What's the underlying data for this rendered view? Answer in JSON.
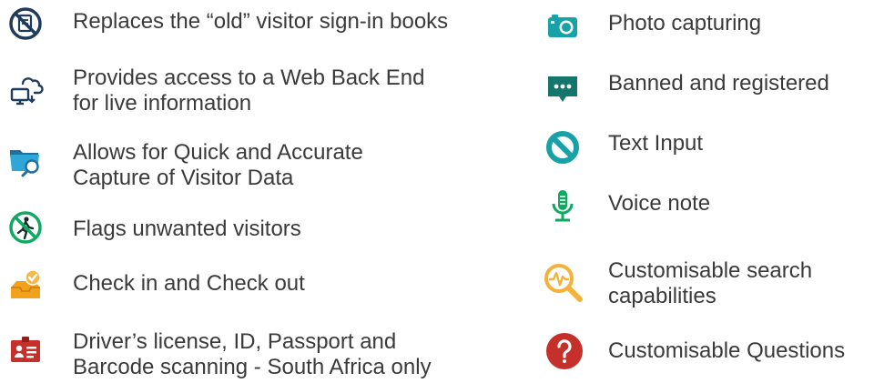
{
  "colors": {
    "navy": "#1f3b5c",
    "teal": "#17a2a8",
    "green": "#11a862",
    "orange": "#f2a11c",
    "red": "#c6302b",
    "gold": "#f3b23a",
    "dark_teal": "#14766c"
  },
  "left_features": [
    {
      "icon": "no-book-icon",
      "lines": [
        "Replaces the “old” visitor sign-in books"
      ]
    },
    {
      "icon": "cloud-computer-icon",
      "lines": [
        "Provides access to a Web Back End",
        "for live information"
      ]
    },
    {
      "icon": "folder-search-icon",
      "lines": [
        "Allows for Quick and Accurate",
        "Capture of Visitor Data"
      ]
    },
    {
      "icon": "no-entry-person-icon",
      "lines": [
        "Flags unwanted visitors"
      ]
    },
    {
      "icon": "inbox-check-icon",
      "lines": [
        "Check in and Check out"
      ]
    },
    {
      "icon": "id-card-icon",
      "lines": [
        "Driver’s license, ID, Passport and",
        "Barcode scanning - South Africa only"
      ]
    }
  ],
  "right_features": [
    {
      "icon": "camera-icon",
      "lines": [
        "Photo capturing"
      ]
    },
    {
      "icon": "chat-bubble-icon",
      "lines": [
        "Banned and registered"
      ]
    },
    {
      "icon": "prohibited-icon",
      "lines": [
        "Text Input"
      ]
    },
    {
      "icon": "microphone-icon",
      "lines": [
        "Voice note"
      ]
    },
    {
      "icon": "search-pulse-icon",
      "lines": [
        "Customisable search",
        "capabilities"
      ]
    },
    {
      "icon": "question-icon",
      "lines": [
        "Customisable Questions"
      ]
    }
  ]
}
